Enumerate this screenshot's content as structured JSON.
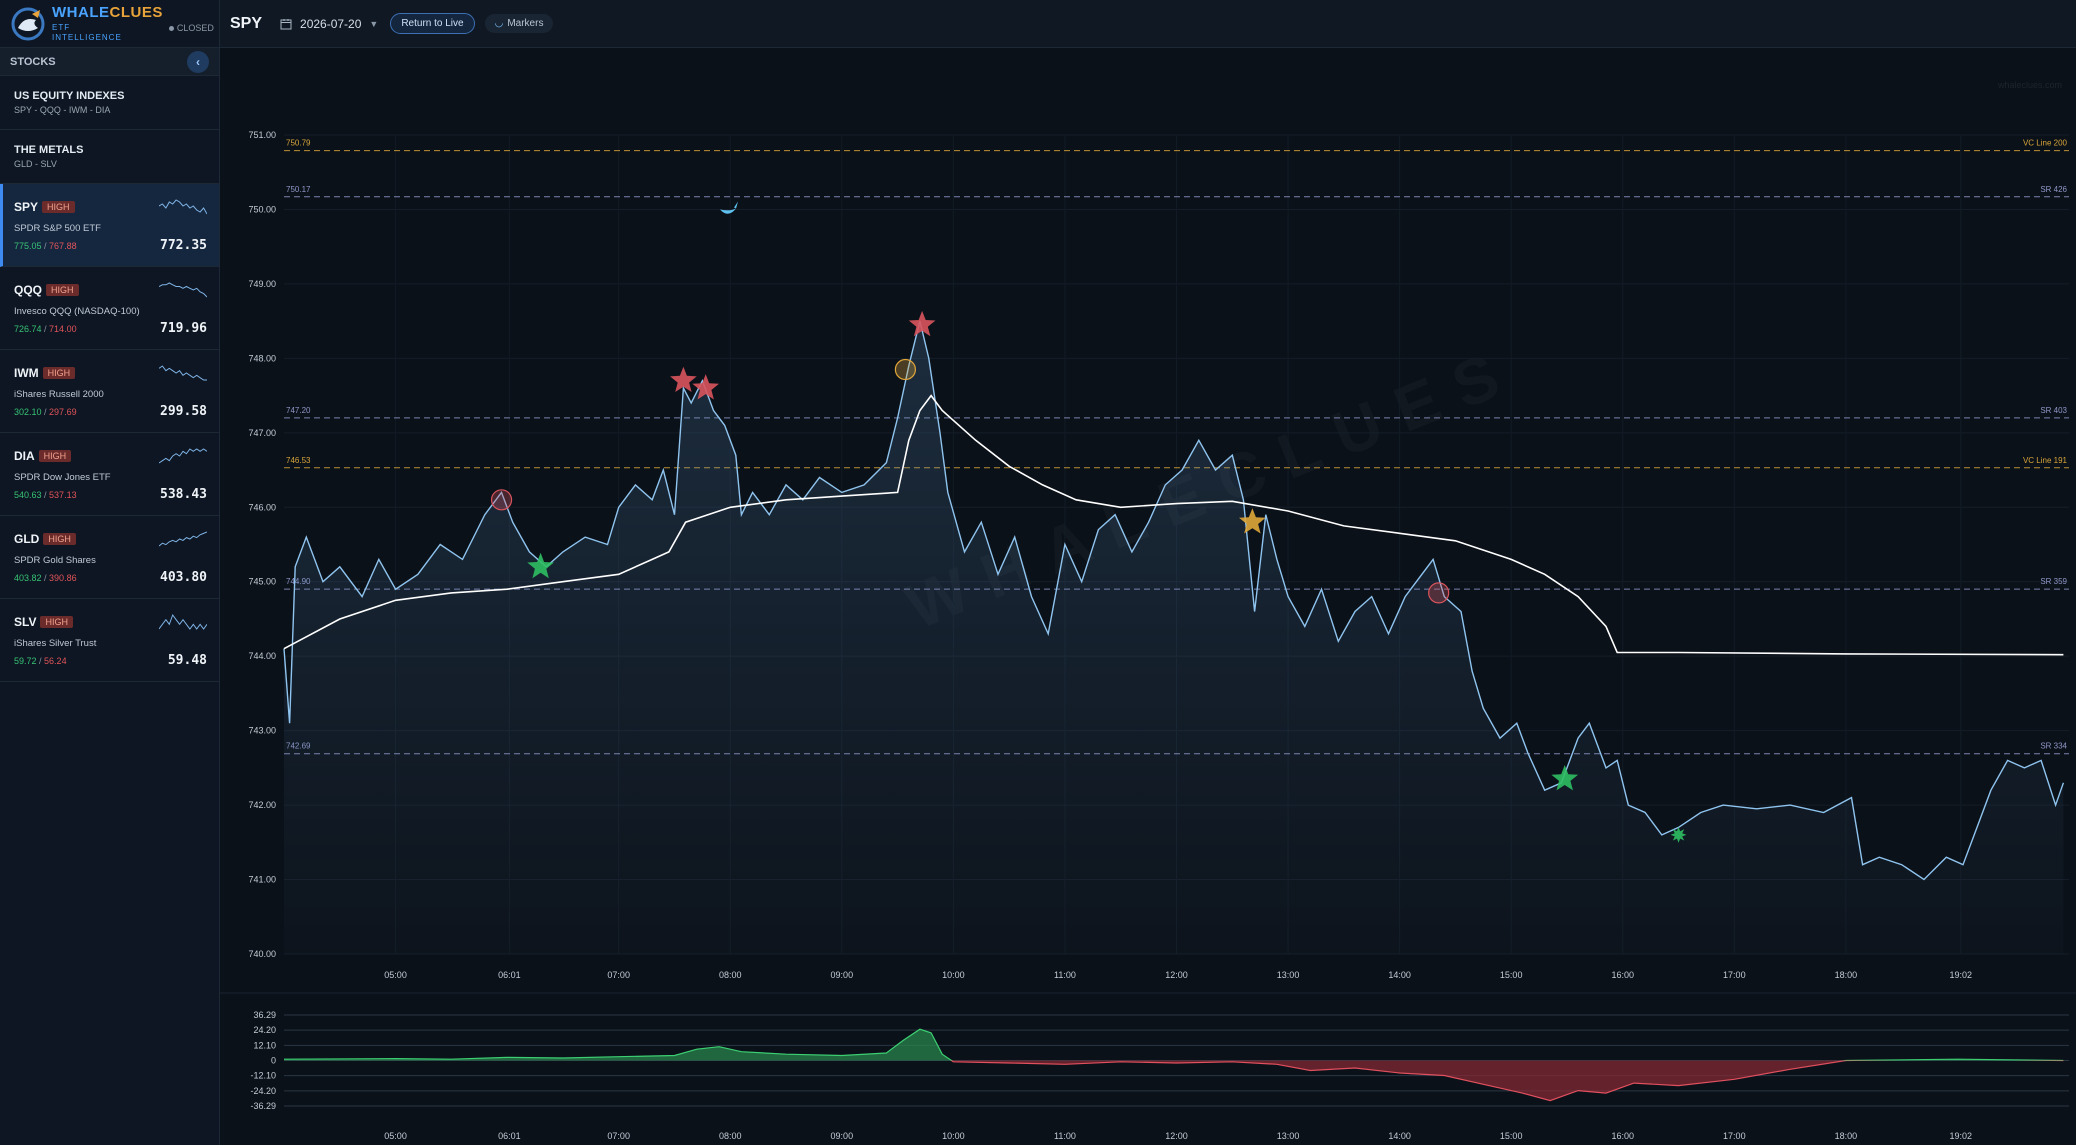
{
  "brand": {
    "name_a": "WHALE",
    "name_b": "CLUES",
    "sub_a": "ETF",
    "sub_b": "INTELLIGENCE",
    "status": "CLOSED"
  },
  "sidebar": {
    "header": "STOCKS",
    "collapse_icon": "chevron-left-icon",
    "groups": [
      {
        "title": "US EQUITY INDEXES",
        "members": "SPY - QQQ - IWM - DIA"
      },
      {
        "title": "THE METALS",
        "members": "GLD - SLV"
      }
    ],
    "tickers": [
      {
        "symbol": "SPY",
        "badge": "HIGH",
        "name": "SPDR S&P 500 ETF",
        "high": "775.05",
        "sep": "/",
        "low": "767.88",
        "price": "772.35",
        "active": true,
        "spark": [
          6,
          5,
          7,
          4,
          5,
          3,
          4,
          6,
          5,
          7,
          6,
          8,
          9,
          7,
          10
        ]
      },
      {
        "symbol": "QQQ",
        "badge": "HIGH",
        "name": "Invesco QQQ (NASDAQ-100)",
        "high": "726.74",
        "sep": "/",
        "low": "714.00",
        "price": "719.96",
        "active": false,
        "spark": [
          5,
          4,
          4,
          3,
          4,
          5,
          5,
          6,
          5,
          6,
          7,
          6,
          8,
          9,
          11
        ]
      },
      {
        "symbol": "IWM",
        "badge": "HIGH",
        "name": "iShares Russell 2000",
        "high": "302.10",
        "sep": "/",
        "low": "297.69",
        "price": "299.58",
        "active": false,
        "spark": [
          4,
          3,
          5,
          4,
          5,
          6,
          5,
          7,
          6,
          7,
          8,
          7,
          8,
          9,
          9
        ]
      },
      {
        "symbol": "DIA",
        "badge": "HIGH",
        "name": "SPDR Dow Jones ETF",
        "high": "540.63",
        "sep": "/",
        "low": "537.13",
        "price": "538.43",
        "active": false,
        "spark": [
          9,
          8,
          7,
          8,
          6,
          5,
          6,
          4,
          5,
          3,
          4,
          3,
          4,
          3,
          4
        ]
      },
      {
        "symbol": "GLD",
        "badge": "HIGH",
        "name": "SPDR Gold Shares",
        "high": "403.82",
        "sep": "/",
        "low": "390.86",
        "price": "403.80",
        "active": false,
        "spark": [
          11,
          9,
          10,
          8,
          7,
          8,
          6,
          7,
          5,
          6,
          4,
          5,
          3,
          2,
          1
        ]
      },
      {
        "symbol": "SLV",
        "badge": "HIGH",
        "name": "iShares Silver Trust",
        "high": "59.72",
        "sep": "/",
        "low": "56.24",
        "price": "59.48",
        "active": false,
        "spark": [
          7,
          6,
          5,
          6,
          4,
          5,
          6,
          5,
          6,
          7,
          6,
          7,
          6,
          7,
          6
        ]
      }
    ]
  },
  "topbar": {
    "symbol": "SPY",
    "date": "2026-07-20",
    "calendar_icon": "calendar-icon",
    "return_live": "Return to Live",
    "markers": "Markers"
  },
  "chart_data": {
    "type": "line",
    "watermark": "WHALECLUES",
    "watermark_url": "whaleclues.com",
    "y_ticks": [
      "751.00",
      "750.00",
      "749.00",
      "748.00",
      "747.00",
      "746.00",
      "745.00",
      "744.00",
      "743.00",
      "742.00",
      "741.00",
      "740.00"
    ],
    "ylim": [
      740,
      751
    ],
    "x_ticks": [
      "05:00",
      "06:01",
      "07:00",
      "08:00",
      "09:00",
      "10:00",
      "11:00",
      "12:00",
      "13:00",
      "14:00",
      "15:00",
      "16:00",
      "17:00",
      "18:00",
      "19:02"
    ],
    "levels": [
      {
        "value": 750.79,
        "label": "750.79",
        "name": "VC Line 200",
        "color": "#d9a63a"
      },
      {
        "value": 750.17,
        "label": "750.17",
        "name": "SR 426",
        "color": "#8f97c8"
      },
      {
        "value": 747.2,
        "label": "747.20",
        "name": "SR 403",
        "color": "#8f97c8"
      },
      {
        "value": 746.53,
        "label": "746.53",
        "name": "VC Line 191",
        "color": "#d9a63a"
      },
      {
        "value": 744.9,
        "label": "744.90",
        "name": "SR 359",
        "color": "#8f97c8"
      },
      {
        "value": 742.69,
        "label": "742.69",
        "name": "SR 334",
        "color": "#8f97c8"
      }
    ],
    "series": [
      {
        "name": "",
        "color": "#8fc4ef",
        "points": [
          [
            4.0,
            744.1
          ],
          [
            4.05,
            743.1
          ],
          [
            4.1,
            745.2
          ],
          [
            4.2,
            745.6
          ],
          [
            4.35,
            745.0
          ],
          [
            4.5,
            745.2
          ],
          [
            4.7,
            744.8
          ],
          [
            4.85,
            745.3
          ],
          [
            5.0,
            744.9
          ],
          [
            5.2,
            745.1
          ],
          [
            5.4,
            745.5
          ],
          [
            5.6,
            745.3
          ],
          [
            5.8,
            745.9
          ],
          [
            5.95,
            746.2
          ],
          [
            6.05,
            745.8
          ],
          [
            6.2,
            745.4
          ],
          [
            6.35,
            745.2
          ],
          [
            6.5,
            745.4
          ],
          [
            6.7,
            745.6
          ],
          [
            6.9,
            745.5
          ],
          [
            7.0,
            746.0
          ],
          [
            7.15,
            746.3
          ],
          [
            7.3,
            746.1
          ],
          [
            7.4,
            746.5
          ],
          [
            7.5,
            745.9
          ],
          [
            7.58,
            747.6
          ],
          [
            7.65,
            747.4
          ],
          [
            7.75,
            747.7
          ],
          [
            7.85,
            747.3
          ],
          [
            7.95,
            747.1
          ],
          [
            8.05,
            746.7
          ],
          [
            8.1,
            745.9
          ],
          [
            8.2,
            746.2
          ],
          [
            8.35,
            745.9
          ],
          [
            8.5,
            746.3
          ],
          [
            8.65,
            746.1
          ],
          [
            8.8,
            746.4
          ],
          [
            9.0,
            746.2
          ],
          [
            9.2,
            746.3
          ],
          [
            9.4,
            746.6
          ],
          [
            9.5,
            747.2
          ],
          [
            9.6,
            747.9
          ],
          [
            9.7,
            748.5
          ],
          [
            9.78,
            748.0
          ],
          [
            9.88,
            747.0
          ],
          [
            9.95,
            746.2
          ],
          [
            10.1,
            745.4
          ],
          [
            10.25,
            745.8
          ],
          [
            10.4,
            745.1
          ],
          [
            10.55,
            745.6
          ],
          [
            10.7,
            744.8
          ],
          [
            10.85,
            744.3
          ],
          [
            11.0,
            745.5
          ],
          [
            11.15,
            745.0
          ],
          [
            11.3,
            745.7
          ],
          [
            11.45,
            745.9
          ],
          [
            11.6,
            745.4
          ],
          [
            11.75,
            745.8
          ],
          [
            11.9,
            746.3
          ],
          [
            12.05,
            746.5
          ],
          [
            12.2,
            746.9
          ],
          [
            12.35,
            746.5
          ],
          [
            12.5,
            746.7
          ],
          [
            12.6,
            746.1
          ],
          [
            12.7,
            744.6
          ],
          [
            12.8,
            745.9
          ],
          [
            12.9,
            745.3
          ],
          [
            13.0,
            744.8
          ],
          [
            13.15,
            744.4
          ],
          [
            13.3,
            744.9
          ],
          [
            13.45,
            744.2
          ],
          [
            13.6,
            744.6
          ],
          [
            13.75,
            744.8
          ],
          [
            13.9,
            744.3
          ],
          [
            14.05,
            744.8
          ],
          [
            14.2,
            745.1
          ],
          [
            14.3,
            745.3
          ],
          [
            14.4,
            744.8
          ],
          [
            14.55,
            744.6
          ],
          [
            14.65,
            743.8
          ],
          [
            14.75,
            743.3
          ],
          [
            14.9,
            742.9
          ],
          [
            15.05,
            743.1
          ],
          [
            15.15,
            742.7
          ],
          [
            15.3,
            742.2
          ],
          [
            15.45,
            742.3
          ],
          [
            15.6,
            742.9
          ],
          [
            15.7,
            743.1
          ],
          [
            15.85,
            742.5
          ],
          [
            15.95,
            742.6
          ],
          [
            16.05,
            742.0
          ],
          [
            16.2,
            741.9
          ],
          [
            16.35,
            741.6
          ],
          [
            16.5,
            741.7
          ],
          [
            16.7,
            741.9
          ],
          [
            16.9,
            742.0
          ],
          [
            17.2,
            741.95
          ],
          [
            17.5,
            742.0
          ],
          [
            17.8,
            741.9
          ],
          [
            18.05,
            742.1
          ],
          [
            18.15,
            741.2
          ],
          [
            18.3,
            741.3
          ],
          [
            18.5,
            741.2
          ],
          [
            18.7,
            741.0
          ],
          [
            18.9,
            741.3
          ],
          [
            19.05,
            741.2
          ],
          [
            19.15,
            741.6
          ],
          [
            19.3,
            742.2
          ],
          [
            19.45,
            742.6
          ],
          [
            19.6,
            742.5
          ],
          [
            19.75,
            742.6
          ],
          [
            19.88,
            742.0
          ],
          [
            19.95,
            742.3
          ]
        ]
      },
      {
        "name": "",
        "color": "#ffffff",
        "points": [
          [
            4.0,
            744.1
          ],
          [
            4.5,
            744.5
          ],
          [
            5.0,
            744.75
          ],
          [
            5.5,
            744.85
          ],
          [
            6.0,
            744.9
          ],
          [
            6.5,
            745.0
          ],
          [
            7.0,
            745.1
          ],
          [
            7.3,
            745.3
          ],
          [
            7.45,
            745.4
          ],
          [
            7.6,
            745.8
          ],
          [
            7.8,
            745.9
          ],
          [
            8.0,
            746.0
          ],
          [
            8.5,
            746.1
          ],
          [
            9.0,
            746.15
          ],
          [
            9.5,
            746.2
          ],
          [
            9.6,
            746.9
          ],
          [
            9.7,
            747.3
          ],
          [
            9.8,
            747.5
          ],
          [
            9.9,
            747.3
          ],
          [
            10.2,
            746.9
          ],
          [
            10.5,
            746.55
          ],
          [
            10.8,
            746.3
          ],
          [
            11.1,
            746.1
          ],
          [
            11.5,
            746.0
          ],
          [
            12.0,
            746.05
          ],
          [
            12.5,
            746.08
          ],
          [
            13.0,
            745.95
          ],
          [
            13.5,
            745.75
          ],
          [
            14.0,
            745.65
          ],
          [
            14.5,
            745.55
          ],
          [
            15.0,
            745.3
          ],
          [
            15.3,
            745.1
          ],
          [
            15.6,
            744.8
          ],
          [
            15.85,
            744.4
          ],
          [
            15.95,
            744.05
          ],
          [
            16.5,
            744.05
          ],
          [
            18.0,
            744.03
          ],
          [
            19.95,
            744.02
          ]
        ]
      }
    ],
    "markers": [
      {
        "icon": "red-star-icon",
        "t": 7.58,
        "v": 747.7,
        "color": "#d9545d"
      },
      {
        "icon": "red-star-icon",
        "t": 7.78,
        "v": 747.6,
        "color": "#d9545d"
      },
      {
        "icon": "red-star-icon",
        "t": 9.72,
        "v": 748.45,
        "color": "#d9545d"
      },
      {
        "icon": "green-star-icon",
        "t": 6.3,
        "v": 745.2,
        "color": "#2fbf63"
      },
      {
        "icon": "green-star-icon",
        "t": 15.48,
        "v": 742.35,
        "color": "#2fbf63"
      },
      {
        "icon": "green-burst-icon",
        "t": 16.5,
        "v": 741.6,
        "color": "#2fbf63"
      },
      {
        "icon": "gold-star-icon",
        "t": 12.68,
        "v": 745.8,
        "color": "#e0a73a"
      },
      {
        "icon": "red-circle-icon",
        "t": 5.95,
        "v": 746.1,
        "color": "#d9545d"
      },
      {
        "icon": "red-circle-icon",
        "t": 14.35,
        "v": 744.85,
        "color": "#d9545d"
      },
      {
        "icon": "gold-circle-icon",
        "t": 9.57,
        "v": 747.85,
        "color": "#e0a73a"
      },
      {
        "icon": "whale-icon",
        "t": 7.98,
        "v": 750.0,
        "color": "#5ec1f0"
      }
    ],
    "sub": {
      "type": "area",
      "y_ticks": [
        "36.29",
        "24.20",
        "12.10",
        "0",
        "-12.10",
        "-24.20",
        "-36.29"
      ],
      "ylim": [
        -36.29,
        36.29
      ],
      "points": [
        [
          4.0,
          1
        ],
        [
          5.0,
          1.5
        ],
        [
          5.5,
          1
        ],
        [
          6.0,
          2.5
        ],
        [
          6.5,
          2
        ],
        [
          7.0,
          3
        ],
        [
          7.5,
          4
        ],
        [
          7.7,
          9
        ],
        [
          7.9,
          11
        ],
        [
          8.1,
          7
        ],
        [
          8.5,
          5
        ],
        [
          9.0,
          4
        ],
        [
          9.4,
          6
        ],
        [
          9.55,
          16
        ],
        [
          9.7,
          25
        ],
        [
          9.8,
          22
        ],
        [
          9.9,
          5
        ],
        [
          10.0,
          -1
        ],
        [
          10.5,
          -2
        ],
        [
          11.0,
          -3
        ],
        [
          11.5,
          -1
        ],
        [
          12.0,
          -2
        ],
        [
          12.5,
          -1
        ],
        [
          12.9,
          -3
        ],
        [
          13.2,
          -8
        ],
        [
          13.6,
          -6
        ],
        [
          14.0,
          -10
        ],
        [
          14.4,
          -12
        ],
        [
          14.8,
          -20
        ],
        [
          15.1,
          -26
        ],
        [
          15.35,
          -32
        ],
        [
          15.6,
          -24
        ],
        [
          15.85,
          -26
        ],
        [
          16.1,
          -18
        ],
        [
          16.5,
          -20
        ],
        [
          17.0,
          -15
        ],
        [
          17.5,
          -7
        ],
        [
          18.0,
          0
        ],
        [
          19.0,
          1
        ],
        [
          19.95,
          0
        ]
      ]
    }
  }
}
